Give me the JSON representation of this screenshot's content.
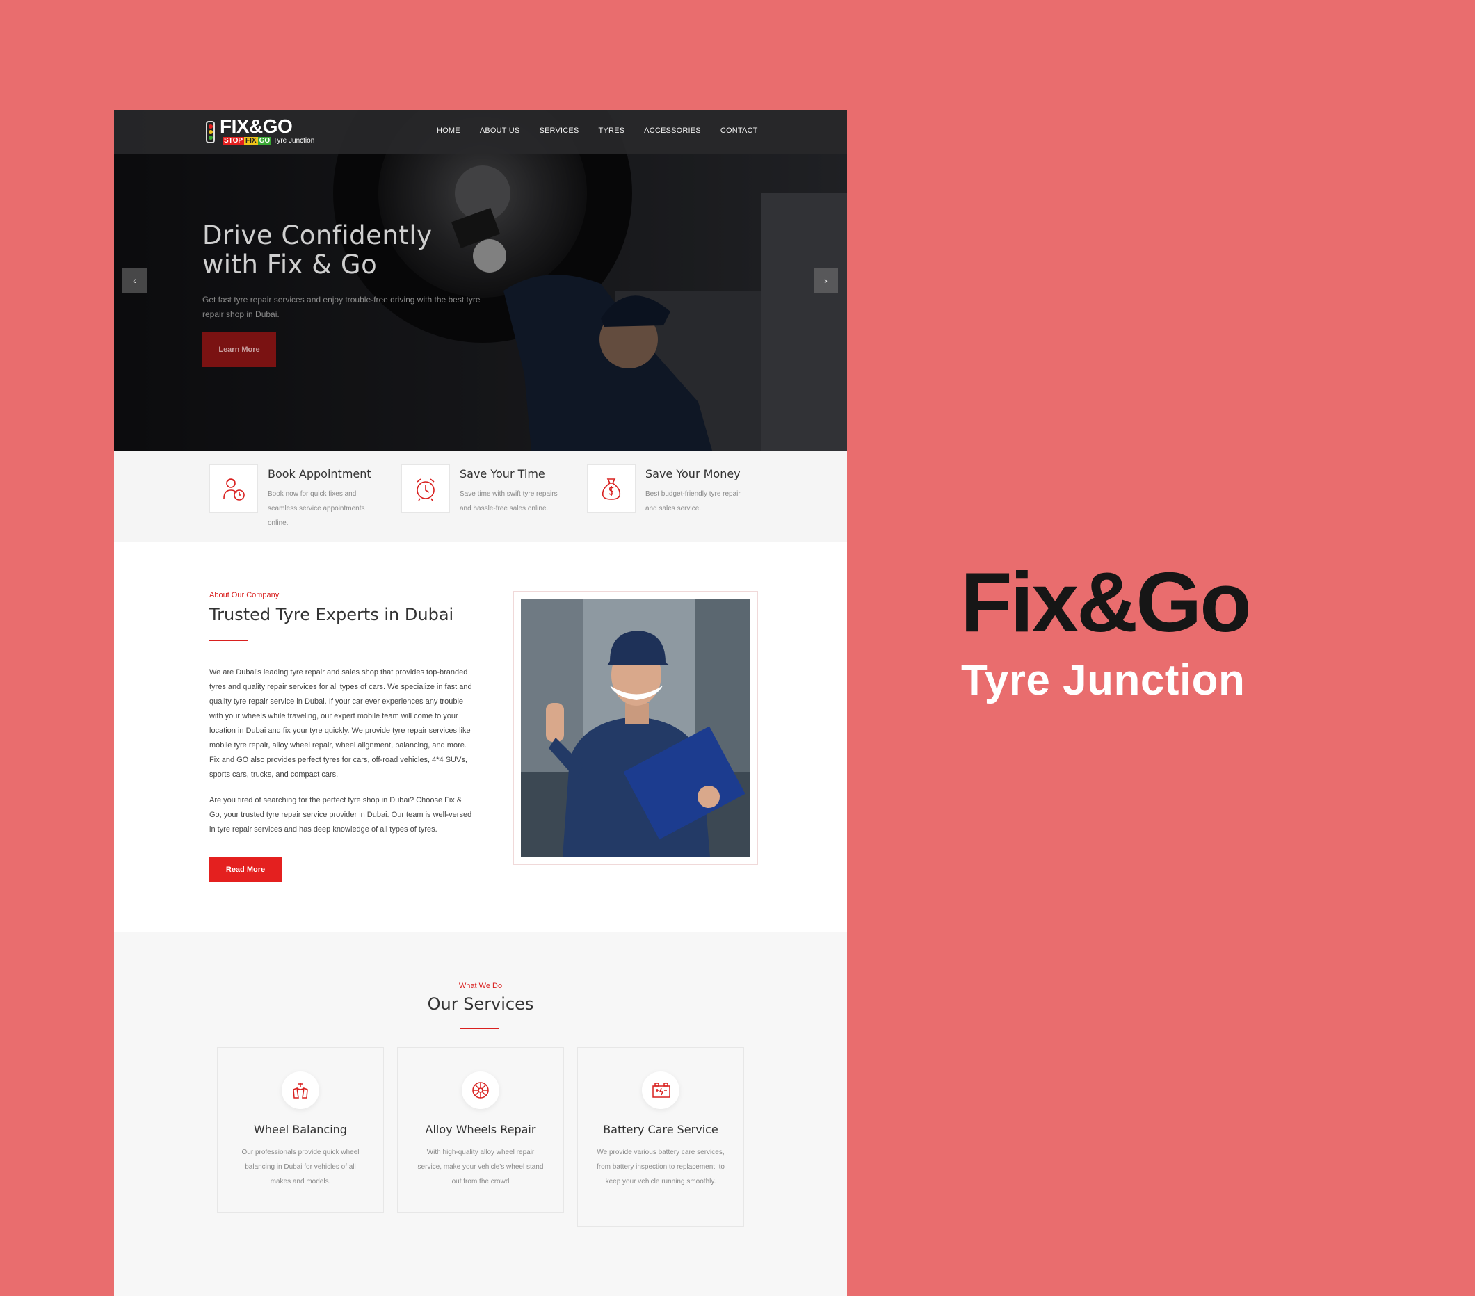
{
  "logo": {
    "brand": "FIX&GO",
    "stop": "STOP",
    "fix": "FIX",
    "go": "GO",
    "tagline": "Tyre Junction"
  },
  "nav": [
    "HOME",
    "ABOUT US",
    "SERVICES",
    "TYRES",
    "ACCESSORIES",
    "CONTACT"
  ],
  "hero": {
    "title_line1": "Drive Confidently",
    "title_line2": "with Fix & Go",
    "subtitle": "Get fast tyre repair services and enjoy trouble-free driving with the best tyre repair shop in Dubai.",
    "button": "Learn More",
    "prev_icon": "‹",
    "next_icon": "›"
  },
  "features": [
    {
      "icon": "mechanic-clock-icon",
      "title": "Book Appointment",
      "text": "Book now for quick fixes and seamless service appointments online."
    },
    {
      "icon": "alarm-clock-icon",
      "title": "Save Your Time",
      "text": "Save time with swift tyre repairs and hassle-free sales online."
    },
    {
      "icon": "money-bag-icon",
      "title": "Save Your Money",
      "text": "Best budget-friendly tyre repair and sales service."
    }
  ],
  "about": {
    "kicker": "About Our Company",
    "title": "Trusted Tyre Experts in Dubai",
    "p1": "We are Dubai’s leading tyre repair and sales shop that provides top-branded tyres and quality repair services for all types of cars. We specialize in fast and quality tyre repair service in Dubai. If your car ever experiences any trouble with your wheels while traveling, our expert mobile team will come to your location in Dubai and fix your tyre quickly. We provide tyre repair services like mobile tyre repair, alloy wheel repair, wheel alignment, balancing, and more. Fix and GO also provides perfect tyres for cars, off-road vehicles, 4*4 SUVs, sports cars, trucks, and compact cars.",
    "p2": "Are you tired of searching for the perfect tyre shop in Dubai? Choose Fix & Go, your trusted tyre repair service provider in Dubai. Our team is well-versed in tyre repair services and has deep knowledge of all types of tyres.",
    "button": "Read More"
  },
  "services": {
    "kicker": "What We Do",
    "title": "Our Services",
    "items": [
      {
        "icon": "wheel-balancing-icon",
        "title": "Wheel Balancing",
        "text": "Our professionals provide quick wheel balancing in Dubai for vehicles of all makes and models."
      },
      {
        "icon": "alloy-wheel-icon",
        "title": "Alloy Wheels Repair",
        "text": "With high-quality alloy wheel repair service, make your vehicle's wheel stand out from the crowd"
      },
      {
        "icon": "battery-icon",
        "title": "Battery Care Service",
        "text": "We provide various battery care services, from battery inspection to replacement, to keep your vehicle running smoothly."
      }
    ]
  },
  "side": {
    "title": "Fix&Go",
    "subtitle": "Tyre Junction"
  },
  "colors": {
    "background": "#e96d6e",
    "accent": "#e4201f",
    "header": "#28282a"
  }
}
